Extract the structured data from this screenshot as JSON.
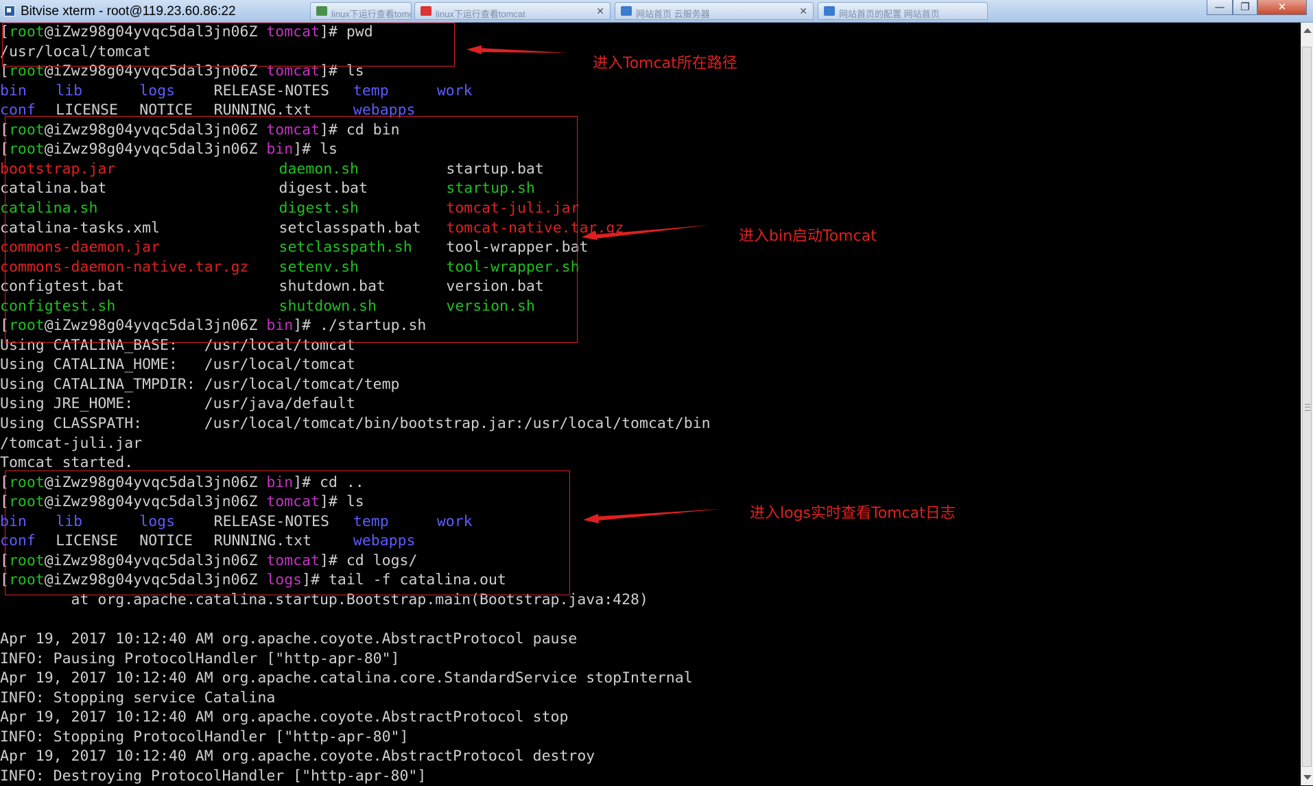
{
  "window": {
    "title": "Bitvise xterm - root@119.23.60.86:22",
    "background_tabs": [
      "linux下运行查看tomcat",
      "linux下运行查看tomcat",
      "网站首页 云服务器",
      "网站首页的配置 网站首页"
    ],
    "controls": {
      "minimize": "—",
      "maximize": "❐",
      "close": "✕"
    }
  },
  "colors": {
    "green": "#1ec21e",
    "magenta": "#c334c3",
    "blue": "#5c5cff",
    "red": "#e02020",
    "white": "#d0d0d0",
    "annotation": "#e02020"
  },
  "terminal": {
    "lines": [
      {
        "segs": [
          [
            "[",
            "white"
          ],
          [
            "root",
            "green"
          ],
          [
            "@iZwz98g04yvqc5dal3jn06Z ",
            "white"
          ],
          [
            "tomcat",
            "magenta"
          ],
          [
            "]# pwd",
            "white"
          ]
        ]
      },
      {
        "segs": [
          [
            "/usr/local/tomcat",
            "white"
          ]
        ]
      },
      {
        "segs": [
          [
            "[",
            "white"
          ],
          [
            "root",
            "green"
          ],
          [
            "@iZwz98g04yvqc5dal3jn06Z ",
            "white"
          ],
          [
            "tomcat",
            "magenta"
          ],
          [
            "]# ls",
            "white"
          ]
        ]
      },
      {
        "cols": [
          [
            0,
            "bin",
            "blue"
          ],
          [
            6,
            "lib",
            "blue"
          ],
          [
            15,
            "logs",
            "blue"
          ],
          [
            23,
            "RELEASE-NOTES",
            "white"
          ],
          [
            38,
            "temp",
            "blue"
          ],
          [
            47,
            "work",
            "blue"
          ]
        ]
      },
      {
        "cols": [
          [
            0,
            "conf",
            "blue"
          ],
          [
            6,
            "LICENSE",
            "white"
          ],
          [
            15,
            "NOTICE",
            "white"
          ],
          [
            23,
            "RUNNING.txt",
            "white"
          ],
          [
            38,
            "webapps",
            "blue"
          ]
        ]
      },
      {
        "segs": [
          [
            "[",
            "white"
          ],
          [
            "root",
            "green"
          ],
          [
            "@iZwz98g04yvqc5dal3jn06Z ",
            "white"
          ],
          [
            "tomcat",
            "magenta"
          ],
          [
            "]# cd bin",
            "white"
          ]
        ]
      },
      {
        "segs": [
          [
            "[",
            "white"
          ],
          [
            "root",
            "green"
          ],
          [
            "@iZwz98g04yvqc5dal3jn06Z ",
            "white"
          ],
          [
            "bin",
            "magenta"
          ],
          [
            "]# ls",
            "white"
          ]
        ]
      },
      {
        "cols": [
          [
            0,
            "bootstrap.jar",
            "red"
          ],
          [
            30,
            "daemon.sh",
            "green"
          ],
          [
            48,
            "startup.bat",
            "white"
          ]
        ]
      },
      {
        "cols": [
          [
            0,
            "catalina.bat",
            "white"
          ],
          [
            30,
            "digest.bat",
            "white"
          ],
          [
            48,
            "startup.sh",
            "green"
          ]
        ]
      },
      {
        "cols": [
          [
            0,
            "catalina.sh",
            "green"
          ],
          [
            30,
            "digest.sh",
            "green"
          ],
          [
            48,
            "tomcat-juli.jar",
            "red"
          ]
        ]
      },
      {
        "cols": [
          [
            0,
            "catalina-tasks.xml",
            "white"
          ],
          [
            30,
            "setclasspath.bat",
            "white"
          ],
          [
            48,
            "tomcat-native.tar.gz",
            "red"
          ]
        ]
      },
      {
        "cols": [
          [
            0,
            "commons-daemon.jar",
            "red"
          ],
          [
            30,
            "setclasspath.sh",
            "green"
          ],
          [
            48,
            "tool-wrapper.bat",
            "white"
          ]
        ]
      },
      {
        "cols": [
          [
            0,
            "commons-daemon-native.tar.gz",
            "red"
          ],
          [
            30,
            "setenv.sh",
            "green"
          ],
          [
            48,
            "tool-wrapper.sh",
            "green"
          ]
        ]
      },
      {
        "cols": [
          [
            0,
            "configtest.bat",
            "white"
          ],
          [
            30,
            "shutdown.bat",
            "white"
          ],
          [
            48,
            "version.bat",
            "white"
          ]
        ]
      },
      {
        "cols": [
          [
            0,
            "configtest.sh",
            "green"
          ],
          [
            30,
            "shutdown.sh",
            "green"
          ],
          [
            48,
            "version.sh",
            "green"
          ]
        ]
      },
      {
        "segs": [
          [
            "[",
            "white"
          ],
          [
            "root",
            "green"
          ],
          [
            "@iZwz98g04yvqc5dal3jn06Z ",
            "white"
          ],
          [
            "bin",
            "magenta"
          ],
          [
            "]# ./startup.sh",
            "white"
          ]
        ]
      },
      {
        "segs": [
          [
            "Using CATALINA_BASE:   /usr/local/tomcat",
            "white"
          ]
        ]
      },
      {
        "segs": [
          [
            "Using CATALINA_HOME:   /usr/local/tomcat",
            "white"
          ]
        ]
      },
      {
        "segs": [
          [
            "Using CATALINA_TMPDIR: /usr/local/tomcat/temp",
            "white"
          ]
        ]
      },
      {
        "segs": [
          [
            "Using JRE_HOME:        /usr/java/default",
            "white"
          ]
        ]
      },
      {
        "segs": [
          [
            "Using CLASSPATH:       /usr/local/tomcat/bin/bootstrap.jar:/usr/local/tomcat/bin",
            "white"
          ]
        ]
      },
      {
        "segs": [
          [
            "/tomcat-juli.jar",
            "white"
          ]
        ]
      },
      {
        "segs": [
          [
            "Tomcat started.",
            "white"
          ]
        ]
      },
      {
        "segs": [
          [
            "[",
            "white"
          ],
          [
            "root",
            "green"
          ],
          [
            "@iZwz98g04yvqc5dal3jn06Z ",
            "white"
          ],
          [
            "bin",
            "magenta"
          ],
          [
            "]# cd ..",
            "white"
          ]
        ]
      },
      {
        "segs": [
          [
            "[",
            "white"
          ],
          [
            "root",
            "green"
          ],
          [
            "@iZwz98g04yvqc5dal3jn06Z ",
            "white"
          ],
          [
            "tomcat",
            "magenta"
          ],
          [
            "]# ls",
            "white"
          ]
        ]
      },
      {
        "cols": [
          [
            0,
            "bin",
            "blue"
          ],
          [
            6,
            "lib",
            "blue"
          ],
          [
            15,
            "logs",
            "blue"
          ],
          [
            23,
            "RELEASE-NOTES",
            "white"
          ],
          [
            38,
            "temp",
            "blue"
          ],
          [
            47,
            "work",
            "blue"
          ]
        ]
      },
      {
        "cols": [
          [
            0,
            "conf",
            "blue"
          ],
          [
            6,
            "LICENSE",
            "white"
          ],
          [
            15,
            "NOTICE",
            "white"
          ],
          [
            23,
            "RUNNING.txt",
            "white"
          ],
          [
            38,
            "webapps",
            "blue"
          ]
        ]
      },
      {
        "segs": [
          [
            "[",
            "white"
          ],
          [
            "root",
            "green"
          ],
          [
            "@iZwz98g04yvqc5dal3jn06Z ",
            "white"
          ],
          [
            "tomcat",
            "magenta"
          ],
          [
            "]# cd logs/",
            "white"
          ]
        ]
      },
      {
        "segs": [
          [
            "[",
            "white"
          ],
          [
            "root",
            "green"
          ],
          [
            "@iZwz98g04yvqc5dal3jn06Z ",
            "white"
          ],
          [
            "logs",
            "magenta"
          ],
          [
            "]# tail -f catalina.out",
            "white"
          ]
        ]
      },
      {
        "segs": [
          [
            "        at org.apache.catalina.startup.Bootstrap.main(Bootstrap.java:428)",
            "white"
          ]
        ]
      },
      {
        "segs": [
          [
            "",
            "white"
          ]
        ]
      },
      {
        "segs": [
          [
            "Apr 19, 2017 10:12:40 AM org.apache.coyote.AbstractProtocol pause",
            "white"
          ]
        ]
      },
      {
        "segs": [
          [
            "INFO: Pausing ProtocolHandler [\"http-apr-80\"]",
            "white"
          ]
        ]
      },
      {
        "segs": [
          [
            "Apr 19, 2017 10:12:40 AM org.apache.catalina.core.StandardService stopInternal",
            "white"
          ]
        ]
      },
      {
        "segs": [
          [
            "INFO: Stopping service Catalina",
            "white"
          ]
        ]
      },
      {
        "segs": [
          [
            "Apr 19, 2017 10:12:40 AM org.apache.coyote.AbstractProtocol stop",
            "white"
          ]
        ]
      },
      {
        "segs": [
          [
            "INFO: Stopping ProtocolHandler [\"http-apr-80\"]",
            "white"
          ]
        ]
      },
      {
        "segs": [
          [
            "Apr 19, 2017 10:12:40 AM org.apache.coyote.AbstractProtocol destroy",
            "white"
          ]
        ]
      },
      {
        "segs": [
          [
            "INFO: Destroying ProtocolHandler [\"http-apr-80\"]",
            "white"
          ]
        ]
      }
    ]
  },
  "annotations": [
    {
      "text": "进入Tomcat所在路径"
    },
    {
      "text": "进入bin启动Tomcat"
    },
    {
      "text": "进入logs实时查看Tomcat日志"
    }
  ]
}
